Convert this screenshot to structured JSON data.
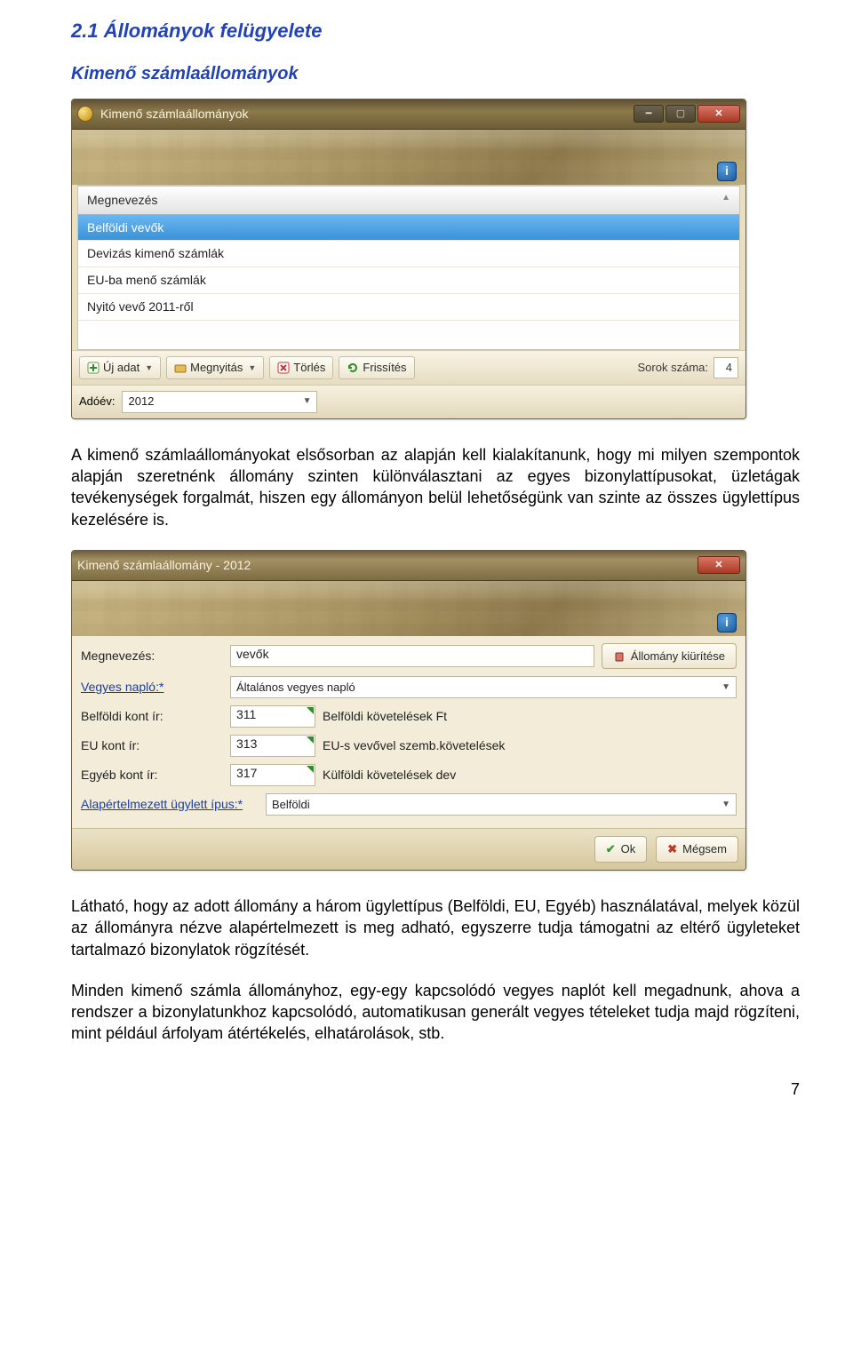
{
  "heading": "2.1 Állományok felügyelete",
  "subheading": "Kimenő számlaállományok",
  "win1": {
    "title": "Kimenő számlaállományok",
    "grid": {
      "header": "Megnevezés",
      "sort_indicator": "▲",
      "rows": [
        "Belföldi vevők",
        "Devizás kimenő számlák",
        "EU-ba menő számlák",
        "Nyitó vevő 2011-ről"
      ],
      "selected_index": 0
    },
    "toolbar": {
      "new": "Új adat",
      "open": "Megnyitás",
      "delete": "Törlés",
      "refresh": "Frissítés",
      "rows_label": "Sorok száma:",
      "rows_value": "4"
    },
    "bottombar": {
      "year_label": "Adóév:",
      "year_value": "2012"
    }
  },
  "para1": "A kimenő számlaállományokat elsősorban az alapján kell kialakítanunk, hogy mi milyen szempontok alapján szeretnénk állomány szinten különválasztani az egyes bizonylattípusokat, üzletágak tevékenységek forgalmát, hiszen egy állományon belül lehetőségünk van szinte az összes ügylettípus kezelésére is.",
  "win2": {
    "title": "Kimenő számlaállomány - 2012",
    "fields": {
      "name_label": "Megnevezés:",
      "name_value": "vevők",
      "clear_label": "Állomány kiürítése",
      "journal_label": "Vegyes napló:*",
      "journal_value": "Általános vegyes napló",
      "dom_label": "Belföldi kont ír:",
      "dom_code": "311",
      "dom_desc": "Belföldi követelések Ft",
      "eu_label": "EU kont ír:",
      "eu_code": "313",
      "eu_desc": "EU-s vevővel szemb.követelések",
      "oth_label": "Egyéb kont ír:",
      "oth_code": "317",
      "oth_desc": "Külföldi követelések dev",
      "def_label": "Alapértelmezett ügylett ípus:*",
      "def_value": "Belföldi"
    },
    "actions": {
      "ok": "Ok",
      "cancel": "Mégsem"
    }
  },
  "para2": "Látható, hogy az adott állomány a három ügylettípus (Belföldi, EU, Egyéb) használatával, melyek közül az állományra nézve alapértelmezett is meg adható, egyszerre tudja támogatni az eltérő ügyleteket tartalmazó bizonylatok rögzítését.",
  "para3": "Minden kimenő számla állományhoz, egy-egy kapcsolódó vegyes naplót kell megadnunk, ahova a rendszer a bizonylatunkhoz kapcsolódó, automatikusan generált vegyes tételeket tudja majd rögzíteni, mint például árfolyam átértékelés, elhatárolások, stb.",
  "page_number": "7",
  "icons": {
    "info": "i"
  }
}
